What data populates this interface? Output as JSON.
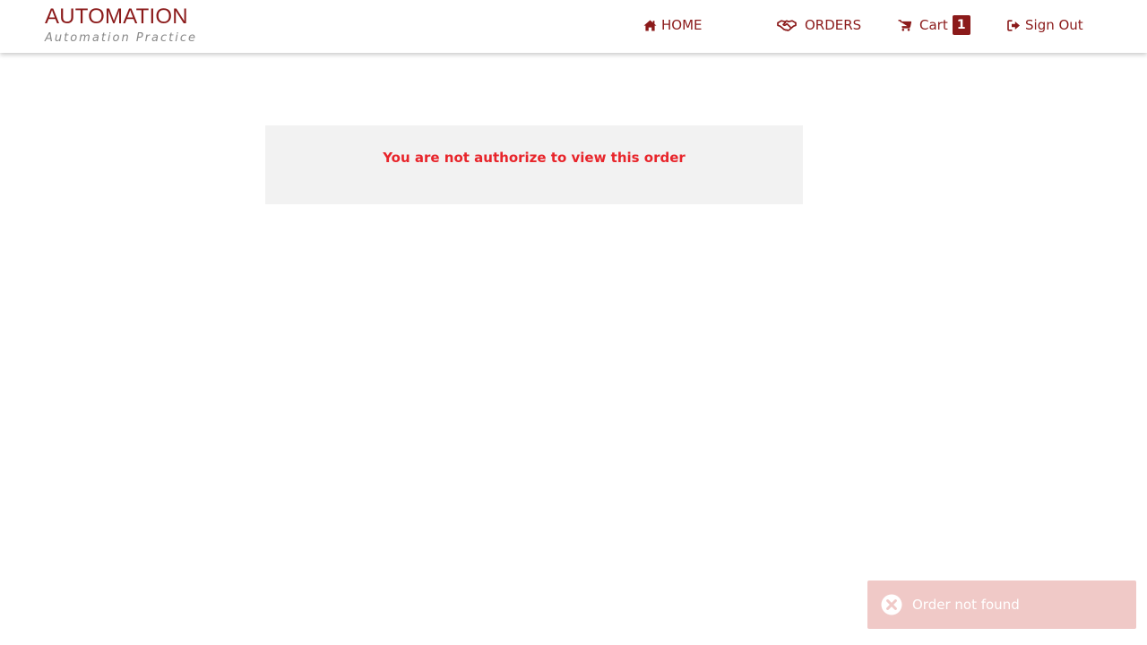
{
  "brand": {
    "title": "AUTOMATION",
    "subtitle": "Automation Practice"
  },
  "nav": {
    "home": {
      "label": "HOME",
      "icon": "home-icon"
    },
    "orders": {
      "label": "ORDERS",
      "icon": "handshake-icon"
    },
    "cart": {
      "label": "Cart",
      "icon": "cart-icon",
      "count": "1"
    },
    "signout": {
      "label": "Sign Out",
      "icon": "sign-out-icon"
    }
  },
  "alert": {
    "message": "You are not authorize to view this order"
  },
  "toast": {
    "message": "Order not found",
    "icon": "close-circle-icon"
  },
  "colors": {
    "brand": "#8b1a1a",
    "alert_text": "#e8252b",
    "toast_bg": "#f0c9c7"
  }
}
